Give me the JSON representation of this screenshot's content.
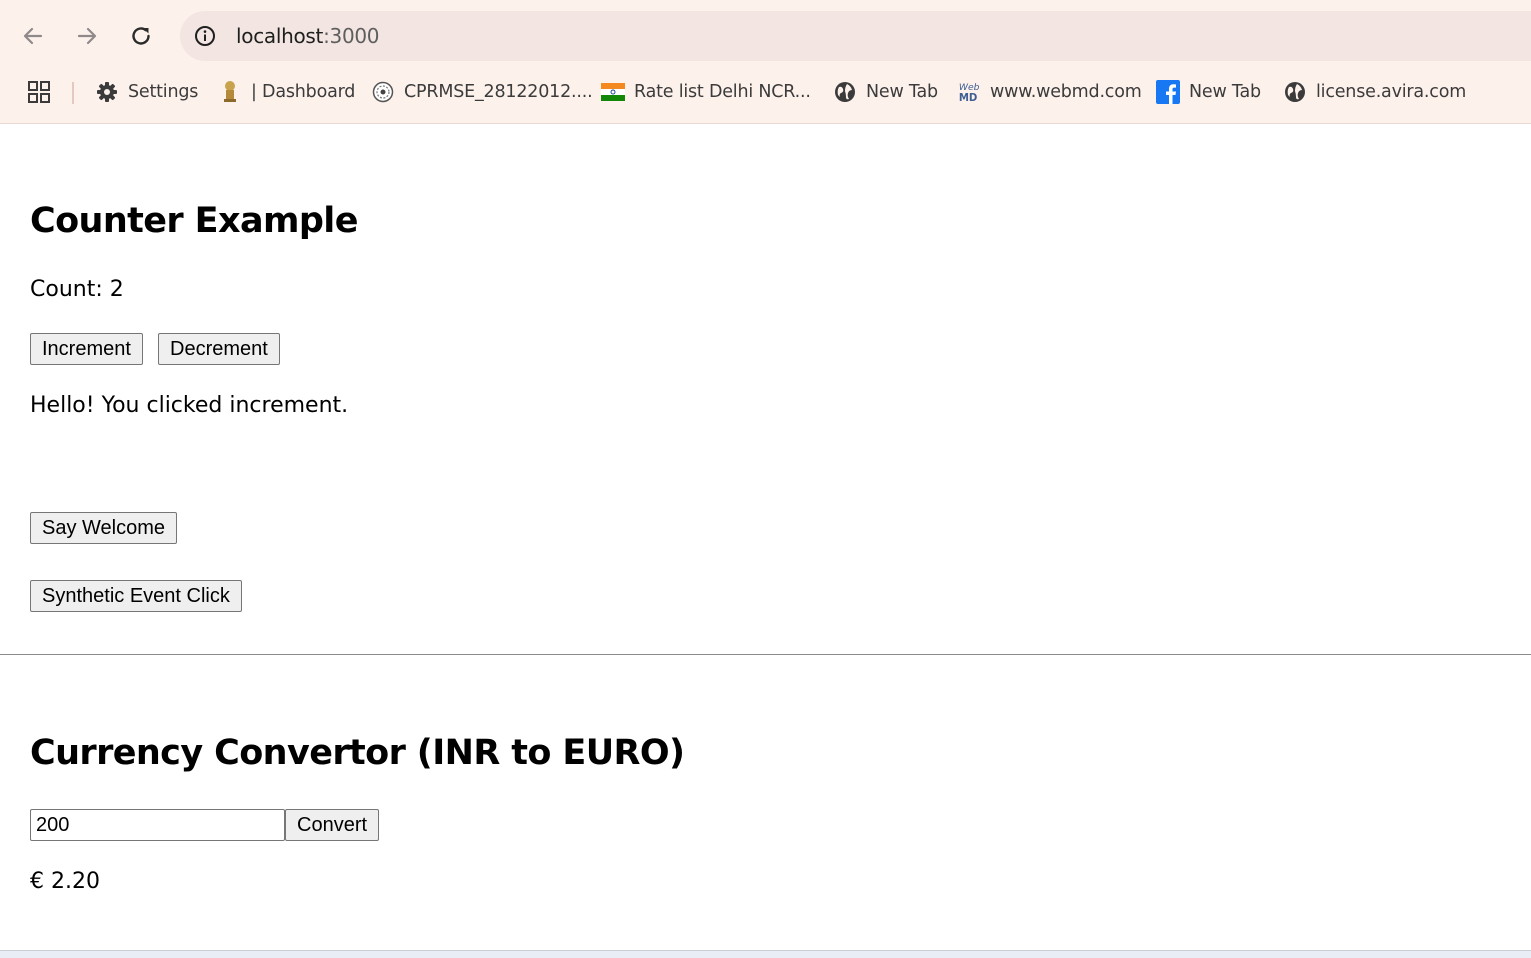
{
  "browser": {
    "url_host": "localhost",
    "url_port": ":3000",
    "bookmarks": [
      {
        "label": "Settings",
        "icon": "gear-icon"
      },
      {
        "label": "| Dashboard",
        "icon": "emblem-icon"
      },
      {
        "label": "CPRMSE_28122012....",
        "icon": "seal-icon"
      },
      {
        "label": "Rate list Delhi NCR...",
        "icon": "india-flag-icon"
      },
      {
        "label": "New Tab",
        "icon": "globe-icon"
      },
      {
        "label": "www.webmd.com",
        "icon": "webmd-icon"
      },
      {
        "label": "New Tab",
        "icon": "facebook-icon"
      },
      {
        "label": "license.avira.com",
        "icon": "globe-icon"
      }
    ]
  },
  "counter": {
    "heading": "Counter Example",
    "count_text": "Count: 2",
    "increment_label": "Increment",
    "decrement_label": "Decrement",
    "message": "Hello! You clicked increment."
  },
  "events": {
    "welcome_label": "Say Welcome",
    "synthetic_label": "Synthetic Event Click"
  },
  "currency": {
    "heading": "Currency Convertor (INR to EURO)",
    "amount_value": "200",
    "convert_label": "Convert",
    "result": "€ 2.20"
  }
}
